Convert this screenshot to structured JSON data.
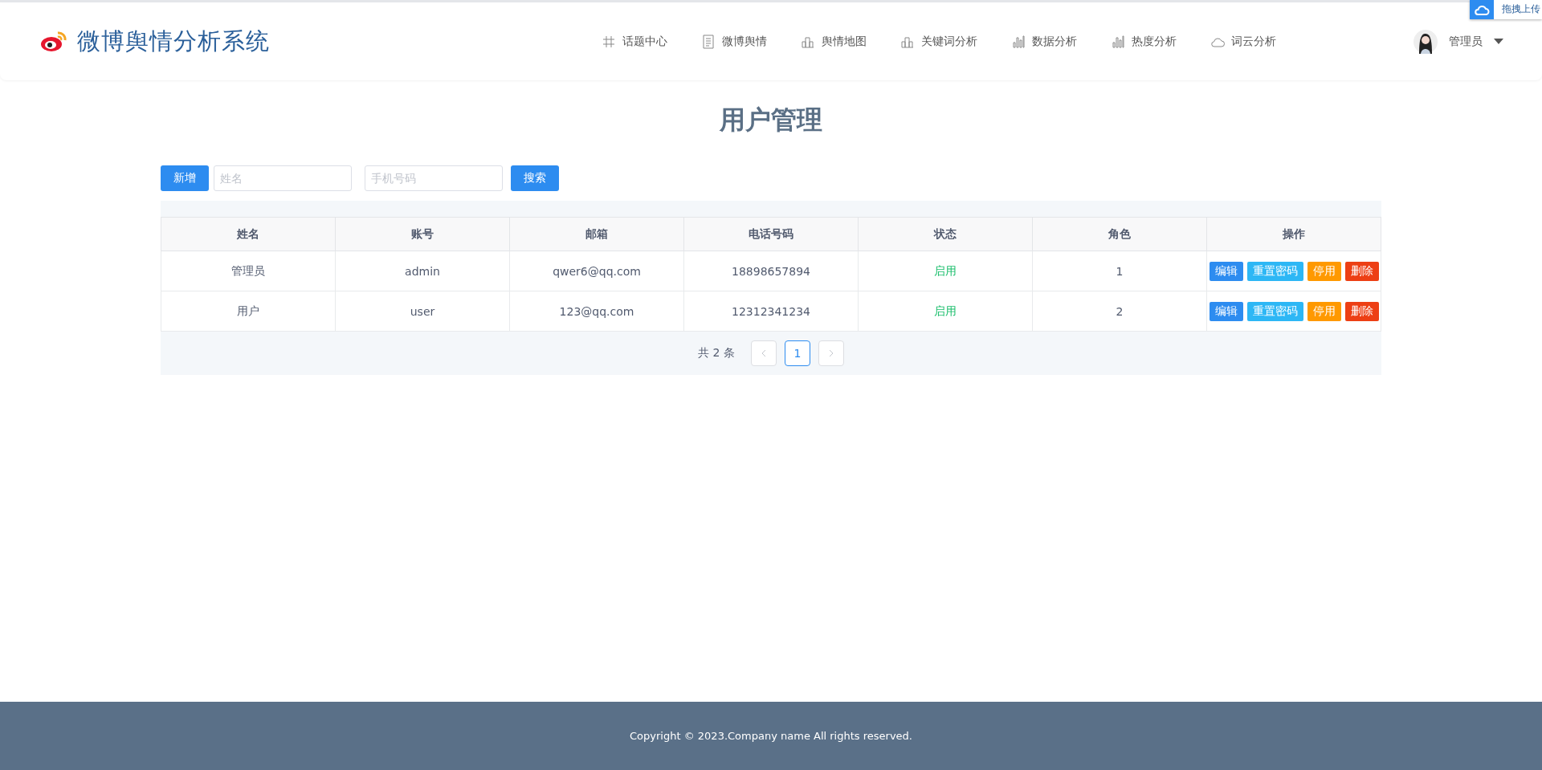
{
  "header": {
    "logo_text": "微博舆情分析系统",
    "nav": [
      {
        "label": "话题中心",
        "kind": "hash"
      },
      {
        "label": "微博舆情",
        "kind": "doc"
      },
      {
        "label": "舆情地图",
        "kind": "blocks"
      },
      {
        "label": "关键词分析",
        "kind": "blocks"
      },
      {
        "label": "数据分析",
        "kind": "bars"
      },
      {
        "label": "热度分析",
        "kind": "bars"
      },
      {
        "label": "词云分析",
        "kind": "cloud"
      }
    ],
    "user": {
      "name": "管理员"
    }
  },
  "upload_widget": {
    "label": "拖拽上传"
  },
  "page_title": "用户管理",
  "toolbar": {
    "add_button": "新增",
    "name_field": {
      "placeholder": "姓名"
    },
    "phone_field": {
      "placeholder": "手机号码"
    },
    "search_button": "搜索"
  },
  "table": {
    "columns": [
      "姓名",
      "账号",
      "邮箱",
      "电话号码",
      "状态",
      "角色",
      "操作"
    ],
    "rows": [
      {
        "name": "管理员",
        "account": "admin",
        "email": "qwer6@qq.com",
        "phone": "18898657894",
        "status": "启用",
        "role": "1",
        "actions": [
          {
            "label": "编辑",
            "kind": "edit"
          },
          {
            "label": "重置密码",
            "kind": "reset"
          },
          {
            "label": "停用",
            "kind": "disable"
          },
          {
            "label": "删除",
            "kind": "delete"
          }
        ]
      },
      {
        "name": "用户",
        "account": "user",
        "email": "123@qq.com",
        "phone": "12312341234",
        "status": "启用",
        "role": "2",
        "actions": [
          {
            "label": "编辑",
            "kind": "edit"
          },
          {
            "label": "重置密码",
            "kind": "reset"
          },
          {
            "label": "停用",
            "kind": "disable"
          },
          {
            "label": "删除",
            "kind": "delete"
          }
        ]
      }
    ]
  },
  "pagination": {
    "total": "共 2 条",
    "prev_disabled": true,
    "next_disabled": true,
    "pages": [
      {
        "label": "1",
        "selected": true
      }
    ]
  },
  "footer": {
    "text": "Copyright © 2023.Company name All rights reserved."
  }
}
